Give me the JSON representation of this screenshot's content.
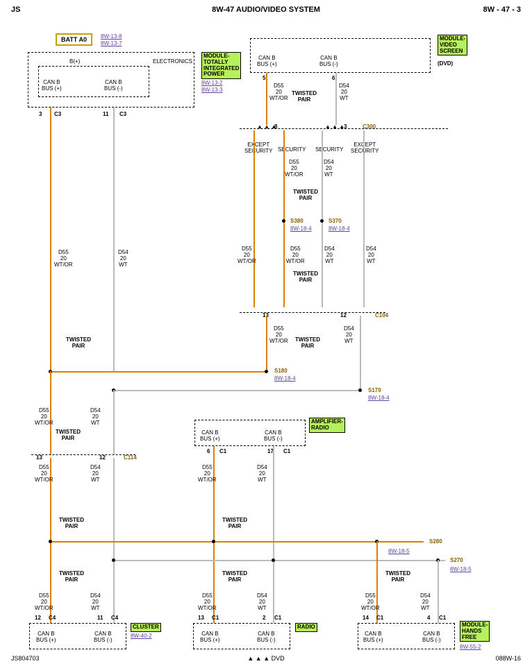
{
  "header": {
    "left": "JS",
    "center": "8W-47 AUDIO/VIDEO SYSTEM",
    "right": "8W - 47 - 3"
  },
  "footer": {
    "left": "JS804703",
    "center": "▲ ▲ ▲  DVD",
    "right": "088W-16"
  },
  "batt": "BATT A0",
  "refs": {
    "batt1": "8W-13-8",
    "batt2": "8W-13-7",
    "tipm1": "8W-13-2",
    "tipm2": "8W-13-3",
    "s380": "8W-18-4",
    "s370": "8W-18-4",
    "s180": "8W-18-4",
    "s170": "8W-18-4",
    "s280": "8W-18-5",
    "s270": "8W-18-5",
    "cluster": "8W-40-2",
    "hf": "8W-55-2"
  },
  "mods": {
    "tipm": "MODULE-\nTOTALLY\nINTEGRATED\nPOWER",
    "video": "MODULE-\nVIDEO\nSCREEN",
    "dvd": "(DVD)",
    "amp": "AMPLIFIER-\nRADIO",
    "cluster": "CLUSTER",
    "radio": "RADIO",
    "hf": "MODULE-\nHANDS\nFREE"
  },
  "labels": {
    "elec": "ELECTRONICS",
    "bplus": "B(+)",
    "canp": "CAN B\nBUS (+)",
    "canm": "CAN B\nBUS (-)",
    "d55": "D55\n20\nWT/OR",
    "d54": "D54\n20\nWT",
    "tw": "TWISTED\nPAIR",
    "exsec": "EXCEPT\nSECURITY",
    "sec": "SECURITY"
  },
  "conns": {
    "c3a": "C3",
    "c3b": "C3",
    "c300": "C300",
    "c104": "C104",
    "c114": "C114",
    "c1a": "C1",
    "c1b": "C1",
    "c1c": "C1",
    "c1d": "C1",
    "c1e": "C1",
    "c1f": "C1",
    "c4a": "C4",
    "c4b": "C4"
  },
  "pins": {
    "p3": "3",
    "p11": "11",
    "p5": "5",
    "p6": "6",
    "p8": "8",
    "p3b": "3",
    "p13": "13",
    "p12": "12",
    "p13b": "13",
    "p12b": "12",
    "p6b": "6",
    "p17": "17",
    "p13c": "13",
    "p2": "2",
    "p12c": "12",
    "p11b": "11",
    "p14": "14",
    "p4": "4"
  },
  "splices": {
    "s380": "S380",
    "s370": "S370",
    "s180": "S180",
    "s170": "S170",
    "s280": "S280",
    "s270": "S270"
  }
}
